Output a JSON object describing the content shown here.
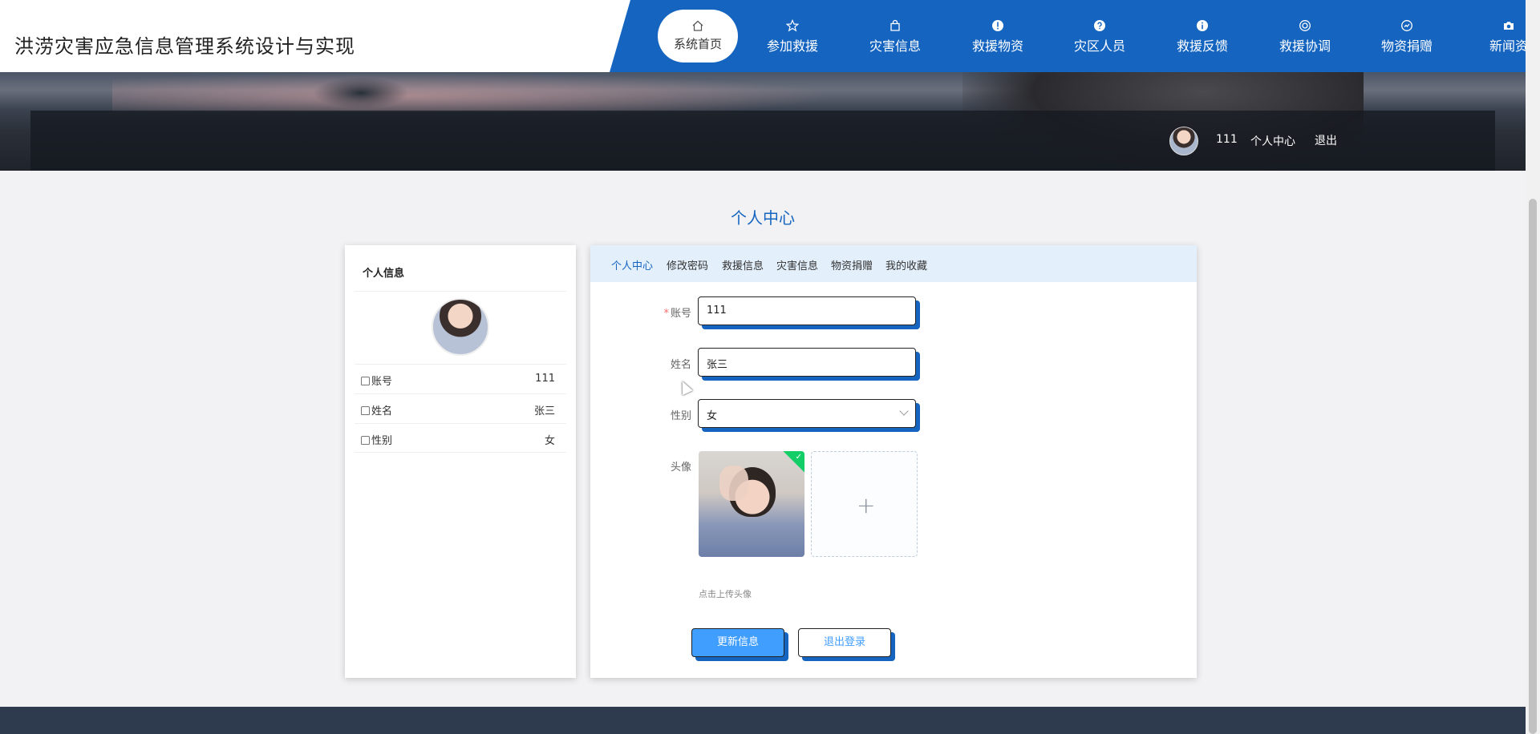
{
  "header": {
    "site_title": "洪涝灾害应急信息管理系统设计与实现",
    "nav": [
      {
        "label": "系统首页",
        "icon": "home-icon",
        "active": true
      },
      {
        "label": "参加救援",
        "icon": "star-icon"
      },
      {
        "label": "灾害信息",
        "icon": "bag-icon"
      },
      {
        "label": "救援物资",
        "icon": "alert-icon"
      },
      {
        "label": "灾区人员",
        "icon": "question-icon"
      },
      {
        "label": "救援反馈",
        "icon": "info-icon"
      },
      {
        "label": "救援协调",
        "icon": "lifebuoy-icon"
      },
      {
        "label": "物资捐赠",
        "icon": "gauge-icon"
      },
      {
        "label": "新闻资",
        "icon": "camera-icon"
      }
    ]
  },
  "user_bar": {
    "username": "111",
    "center_link": "个人中心",
    "logout_link": "退出"
  },
  "page_title": "个人中心",
  "left_card": {
    "heading": "个人信息",
    "rows": [
      {
        "label": "账号",
        "value": "111"
      },
      {
        "label": "姓名",
        "value": "张三"
      },
      {
        "label": "性别",
        "value": "女"
      }
    ]
  },
  "tabs": [
    "个人中心",
    "修改密码",
    "救援信息",
    "灾害信息",
    "物资捐赠",
    "我的收藏"
  ],
  "form": {
    "account_label": "账号",
    "account_value": "111",
    "name_label": "姓名",
    "name_value": "张三",
    "gender_label": "性别",
    "gender_value": "女",
    "avatar_label": "头像",
    "upload_hint": "点击上传头像",
    "update_button": "更新信息",
    "logout_button": "退出登录",
    "required_mark": "*"
  },
  "colors": {
    "brand": "#1565c0",
    "primary_button": "#409eff",
    "footer": "#2e3b4e"
  }
}
